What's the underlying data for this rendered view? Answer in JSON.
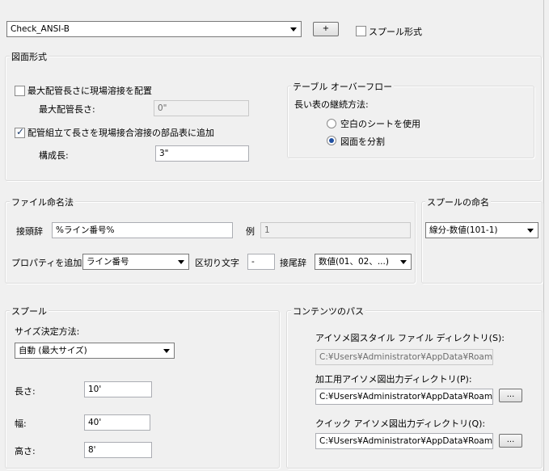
{
  "top": {
    "format_combo": "Check_ANSI-B",
    "add_button": "+",
    "spool_format_label": "スプール形式"
  },
  "drawing_format": {
    "title": "図面形式",
    "max_length_checkbox_label": "最大配管長さに現場溶接を配置",
    "max_length_label": "最大配管長さ:",
    "max_length_value": "0\"",
    "add_weld_checkbox_label": "配管組立て長さを現場接合溶接の部品表に追加",
    "config_length_label": "構成長:",
    "config_length_value": "3\""
  },
  "table_overflow": {
    "title": "テーブル オーバーフロー",
    "continuation_label": "長い表の継続方法:",
    "option_blank_sheet": "空白のシートを使用",
    "option_split": "図面を分割"
  },
  "file_naming": {
    "title": "ファイル命名法",
    "prefix_label": "接頭辞",
    "prefix_value": "%ライン番号%",
    "example_label": "例",
    "example_value": "1",
    "add_property_label": "プロパティを追加",
    "property_combo": "ライン番号",
    "separator_label": "区切り文字",
    "separator_value": "-",
    "suffix_label": "接尾辞",
    "suffix_combo": "数値(01、02、...)"
  },
  "spool_naming": {
    "title": "スプールの命名",
    "combo": "線分-数値(101-1)"
  },
  "spool": {
    "title": "スプール",
    "size_method_label": "サイズ決定方法:",
    "size_method_combo": "自動 (最大サイズ)",
    "length_label": "長さ:",
    "length_value": "10'",
    "width_label": "幅:",
    "width_value": "40'",
    "height_label": "高さ:",
    "height_value": "8'"
  },
  "content_path": {
    "title": "コンテンツのパス",
    "style_dir_label": "アイソメ図スタイル ファイル ディレクトリ(S):",
    "style_dir_value": "C:¥Users¥Administrator¥AppData¥Roaming",
    "fab_dir_label": "加工用アイソメ図出力ディレクトリ(P):",
    "fab_dir_value": "C:¥Users¥Administrator¥AppData¥Roaming",
    "quick_dir_label": "クイック アイソメ図出力ディレクトリ(Q):",
    "quick_dir_value": "C:¥Users¥Administrator¥AppData¥Roaming",
    "browse_label": "..."
  }
}
